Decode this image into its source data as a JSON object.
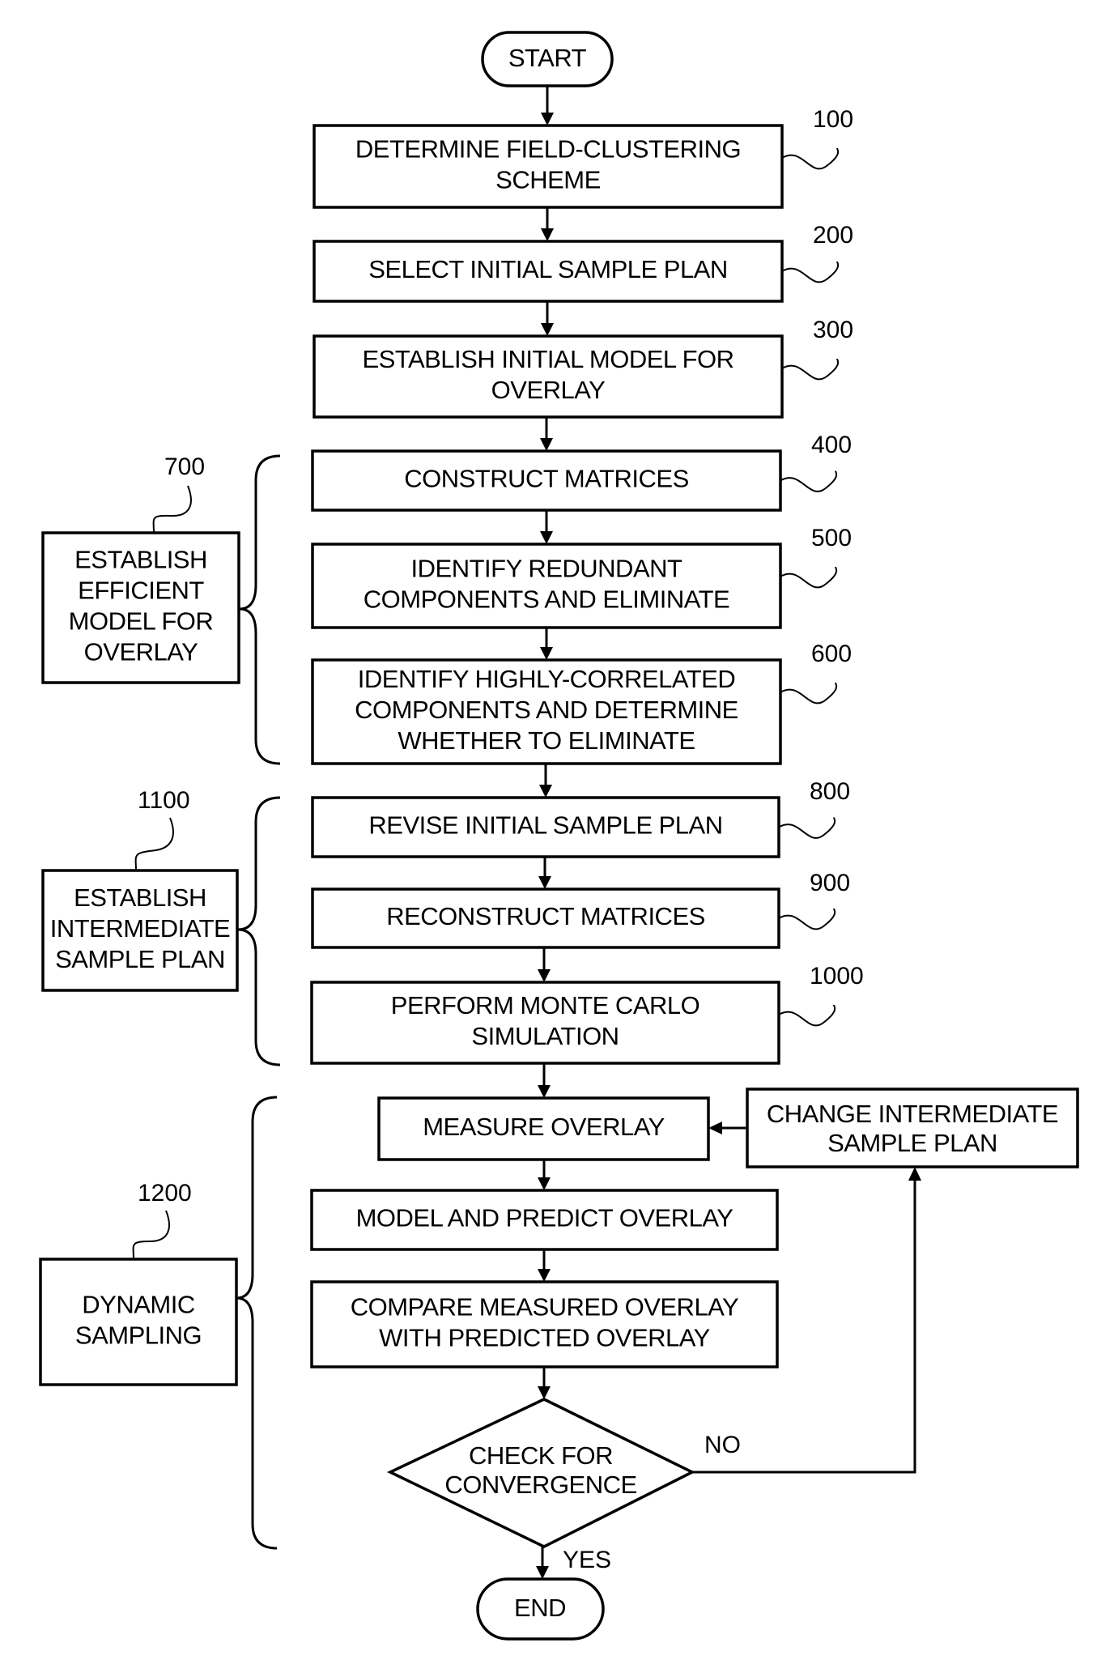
{
  "figure": {
    "terminals": {
      "start": "START",
      "end": "END"
    },
    "steps": [
      {
        "ref": "100",
        "lines": [
          "DETERMINE FIELD-CLUSTERING",
          "SCHEME"
        ]
      },
      {
        "ref": "200",
        "lines": [
          "SELECT INITIAL SAMPLE PLAN"
        ]
      },
      {
        "ref": "300",
        "lines": [
          "ESTABLISH INITIAL MODEL FOR",
          "OVERLAY"
        ]
      },
      {
        "ref": "400",
        "lines": [
          "CONSTRUCT MATRICES"
        ]
      },
      {
        "ref": "500",
        "lines": [
          "IDENTIFY REDUNDANT",
          "COMPONENTS AND ELIMINATE"
        ]
      },
      {
        "ref": "600",
        "lines": [
          "IDENTIFY HIGHLY-CORRELATED",
          "COMPONENTS AND DETERMINE",
          "WHETHER TO ELIMINATE"
        ]
      },
      {
        "ref": "800",
        "lines": [
          "REVISE INITIAL SAMPLE PLAN"
        ]
      },
      {
        "ref": "900",
        "lines": [
          "RECONSTRUCT MATRICES"
        ]
      },
      {
        "ref": "1000",
        "lines": [
          "PERFORM MONTE CARLO",
          "SIMULATION"
        ]
      },
      {
        "ref": "",
        "lines": [
          "MEASURE OVERLAY"
        ]
      },
      {
        "ref": "",
        "lines": [
          "MODEL AND PREDICT OVERLAY"
        ]
      },
      {
        "ref": "",
        "lines": [
          "COMPARE MEASURED OVERLAY",
          "WITH PREDICTED OVERLAY"
        ]
      }
    ],
    "change_box": {
      "lines": [
        "CHANGE INTERMEDIATE",
        "SAMPLE PLAN"
      ]
    },
    "decision": {
      "lines": [
        "CHECK FOR",
        "CONVERGENCE"
      ],
      "yes_label": "YES",
      "no_label": "NO"
    },
    "groups": [
      {
        "ref": "700",
        "lines": [
          "ESTABLISH",
          "EFFICIENT",
          "MODEL FOR",
          "OVERLAY"
        ]
      },
      {
        "ref": "1100",
        "lines": [
          "ESTABLISH",
          "INTERMEDIATE",
          "SAMPLE PLAN"
        ]
      },
      {
        "ref": "1200",
        "lines": [
          "DYNAMIC",
          "SAMPLING"
        ]
      }
    ]
  }
}
